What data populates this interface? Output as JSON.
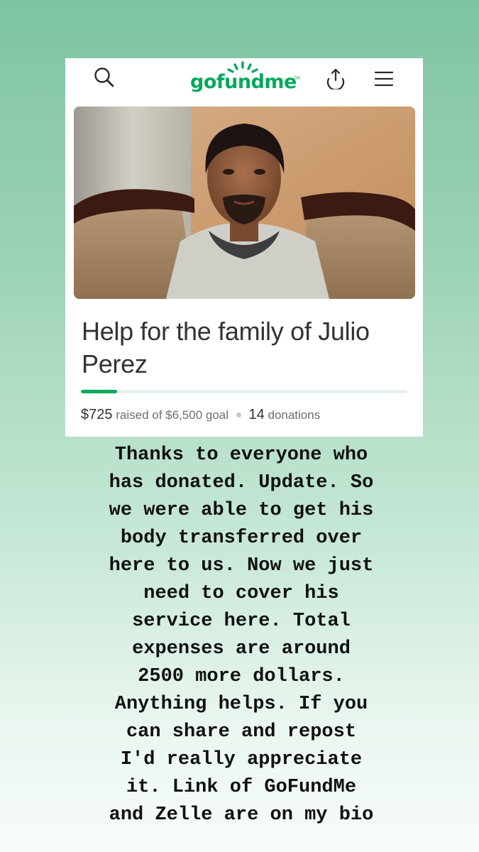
{
  "header": {
    "logo_text": "gofundme",
    "logo_tm": "TM",
    "icons": [
      "search-icon",
      "gofundme-logo",
      "share-icon",
      "menu-icon"
    ]
  },
  "campaign": {
    "title": "Help for the family of Julio Perez",
    "raised_amount": "$725",
    "raised_label": "raised of $6,500 goal",
    "donation_count": "14",
    "donation_label": "donations",
    "progress_fraction": 0.11
  },
  "caption": {
    "lines": [
      "Thanks to everyone who",
      "has donated. Update. So",
      "we were able to get his",
      "body transferred over",
      "here to us. Now we just",
      "need to cover his",
      "service here. Total",
      "expenses are around",
      "2500 more dollars.",
      "Anything helps. If you",
      "can share and repost",
      "I'd really appreciate",
      "it. Link of GoFundMe",
      "and Zelle are on my bio"
    ]
  },
  "colors": {
    "brand_green": "#02a95c",
    "background_top": "#7ec4a2",
    "background_bottom": "#f8fcf9"
  }
}
